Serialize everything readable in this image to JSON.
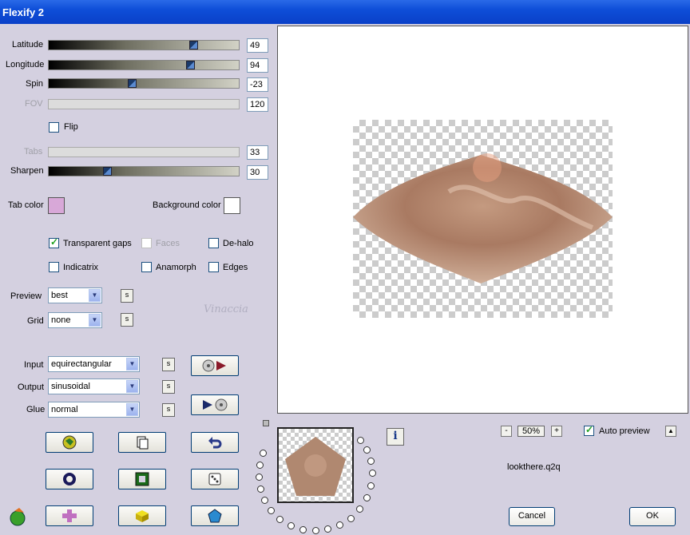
{
  "window": {
    "title": "Flexify 2"
  },
  "sliders": [
    {
      "label": "Latitude",
      "value": "49",
      "enabled": true,
      "level": 0.76
    },
    {
      "label": "Longitude",
      "value": "94",
      "enabled": true,
      "level": 0.74
    },
    {
      "label": "Spin",
      "value": "-23",
      "enabled": true,
      "level": 0.44
    },
    {
      "label": "FOV",
      "value": "120",
      "enabled": false,
      "level": 0
    },
    {
      "label": "Tabs",
      "value": "33",
      "enabled": false,
      "level": 0
    },
    {
      "label": "Sharpen",
      "value": "30",
      "enabled": true,
      "level": 0.3
    }
  ],
  "flip": {
    "label": "Flip",
    "checked": false
  },
  "colors": {
    "tab_color_label": "Tab color",
    "tab_color": "#d8a8d8",
    "background_color_label": "Background color",
    "background_color": "#ffffff"
  },
  "options": {
    "transparent_gaps": {
      "label": "Transparent gaps",
      "checked": true
    },
    "faces": {
      "label": "Faces",
      "checked": false,
      "enabled": false
    },
    "de_halo": {
      "label": "De-halo",
      "checked": false
    },
    "indicatrix": {
      "label": "Indicatrix",
      "checked": false
    },
    "anamorph": {
      "label": "Anamorph",
      "checked": false
    },
    "edges": {
      "label": "Edges",
      "checked": false
    }
  },
  "preview_select": {
    "label": "Preview",
    "value": "best"
  },
  "grid_select": {
    "label": "Grid",
    "value": "none"
  },
  "input_select": {
    "label": "Input",
    "value": "equirectangular"
  },
  "output_select": {
    "label": "Output",
    "value": "sinusoidal"
  },
  "glue_select": {
    "label": "Glue",
    "value": "normal"
  },
  "s_label": "s",
  "zoom": {
    "minus": "-",
    "value": "50%",
    "plus": "+"
  },
  "auto_preview": {
    "label": "Auto preview",
    "checked": true
  },
  "auto_preview_toggle": "▲",
  "filename": "lookthere.q2q",
  "buttons": {
    "cancel": "Cancel",
    "ok": "OK"
  },
  "info_label": "i",
  "watermark": "Vinaccia"
}
